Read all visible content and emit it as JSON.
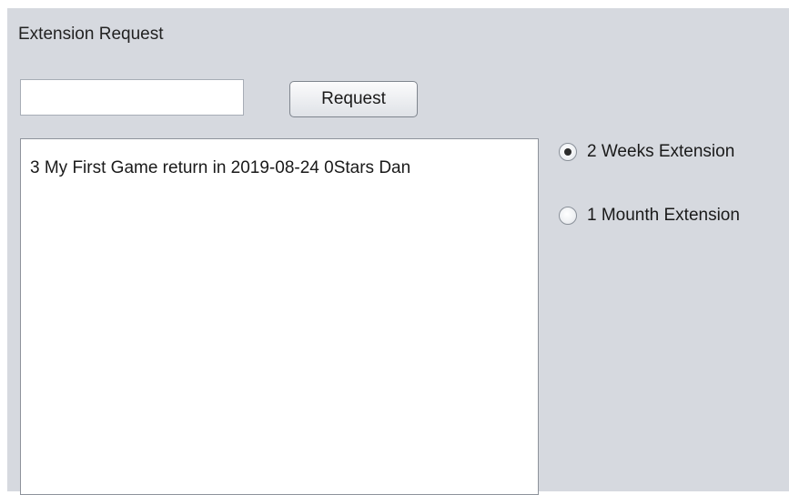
{
  "window": {
    "title": "Extension Request"
  },
  "request_form": {
    "input_value": "",
    "button_label": "Request"
  },
  "list": {
    "items": [
      "3 My First Game return in 2019-08-24 0Stars Dan"
    ]
  },
  "options": [
    {
      "label": "2 Weeks Extension",
      "selected": true
    },
    {
      "label": "1 Mounth Extension",
      "selected": false
    }
  ]
}
